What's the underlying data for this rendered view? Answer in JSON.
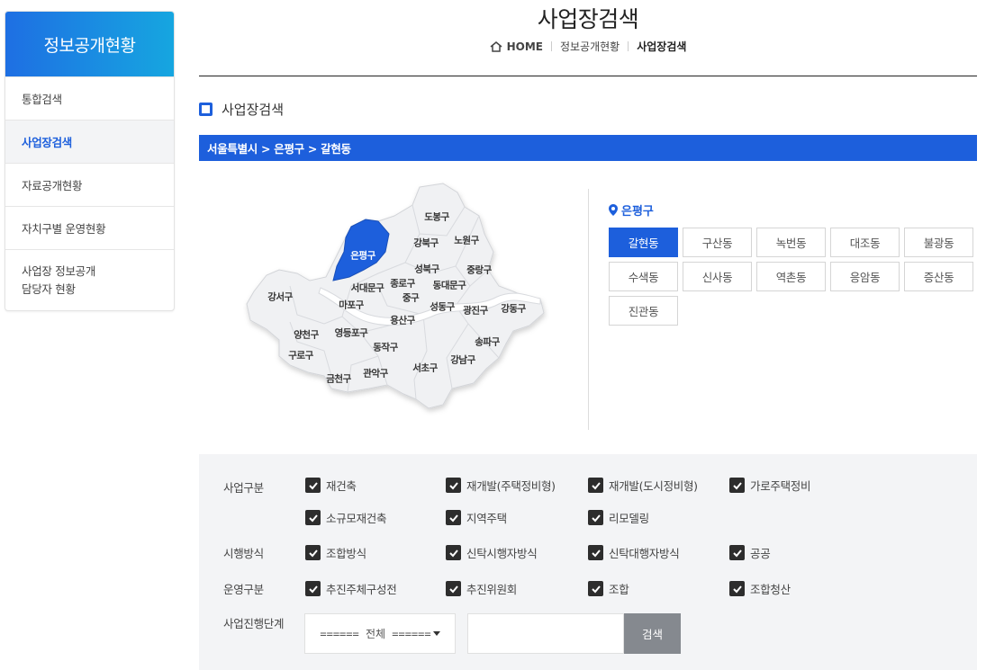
{
  "sidebar": {
    "title": "정보공개현황",
    "items": [
      {
        "label": "통합검색"
      },
      {
        "label": "사업장검색"
      },
      {
        "label": "자료공개현황"
      },
      {
        "label": "자치구별 운영현황"
      },
      {
        "label_line1": "사업장 정보공개",
        "label_line2": "담당자 현황"
      }
    ]
  },
  "header": {
    "title": "사업장검색",
    "breadcrumb": {
      "home": "HOME",
      "parent": "정보공개현황",
      "current": "사업장검색"
    }
  },
  "section": {
    "title": "사업장검색",
    "location": "서울특별시 > 은평구 > 갈현동"
  },
  "map": {
    "selected": "은평구",
    "districts": [
      "도봉구",
      "강북구",
      "노원구",
      "은평구",
      "성북구",
      "중랑구",
      "서대문구",
      "종로구",
      "동대문구",
      "강서구",
      "마포구",
      "중구",
      "성동구",
      "광진구",
      "강동구",
      "용산구",
      "양천구",
      "영등포구",
      "동작구",
      "송파구",
      "구로구",
      "강남구",
      "서초구",
      "관악구",
      "금천구"
    ]
  },
  "dong_panel": {
    "gu": "은평구",
    "dongs": [
      "갈현동",
      "구산동",
      "녹번동",
      "대조동",
      "불광동",
      "수색동",
      "신사동",
      "역촌동",
      "응암동",
      "증산동",
      "진관동"
    ]
  },
  "filters": {
    "business_type": {
      "label": "사업구분",
      "options": [
        "재건축",
        "재개발(주택정비형)",
        "재개발(도시정비형)",
        "가로주택정비",
        "소규모재건축",
        "지역주택",
        "리모델링"
      ]
    },
    "exec_method": {
      "label": "시행방식",
      "options": [
        "조합방식",
        "신탁시행자방식",
        "신탁대행자방식",
        "공공"
      ]
    },
    "operation_type": {
      "label": "운영구분",
      "options": [
        "추진주체구성전",
        "추진위원회",
        "조합",
        "조합청산"
      ]
    },
    "stage": {
      "label": "사업진행단계",
      "select_value": "====== 전체 ======",
      "search_value": "",
      "search_button": "검색"
    }
  },
  "colors": {
    "primary": "#1d5fdc",
    "sidebar_gradient_end": "#16a6e0",
    "filter_bg": "#f3f4f6",
    "search_button": "#85898f"
  }
}
